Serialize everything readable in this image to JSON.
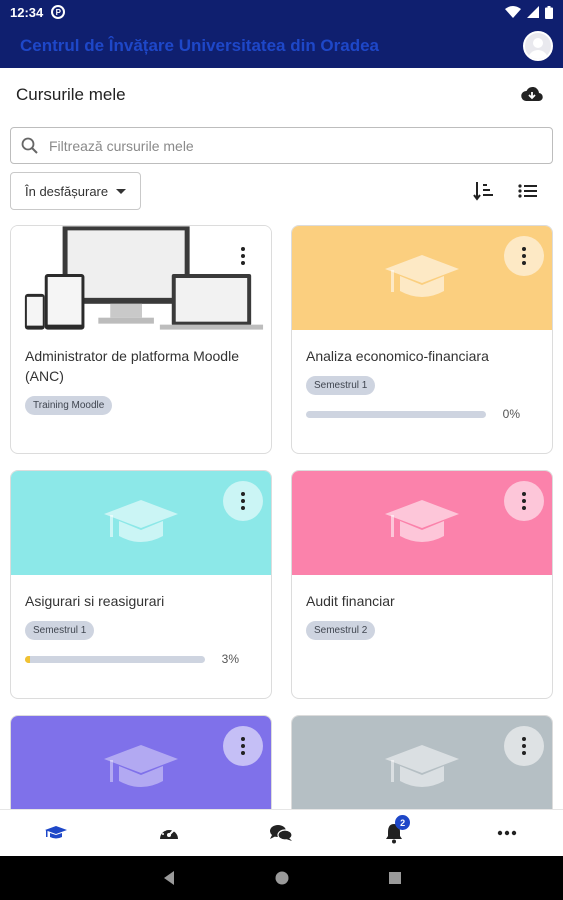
{
  "status_bar": {
    "time": "12:34",
    "notification_icon": "P"
  },
  "app_bar": {
    "title": "Centrul de Învățare Universitatea din Oradea"
  },
  "page": {
    "title": "Cursurile mele"
  },
  "search": {
    "placeholder": "Filtrează cursurile mele"
  },
  "filter": {
    "selected": "În desfășurare"
  },
  "courses": [
    {
      "name": "Administrator de platforma Moodle (ANC)",
      "category": "Training Moodle",
      "image": "devices-illustration",
      "color": "#ffffff",
      "progress": null
    },
    {
      "name": "Analiza economico-financiara",
      "category": "Semestrul 1",
      "image": "graduation-cap",
      "color": "#fbcf7f",
      "progress": 0,
      "progress_label": "0%"
    },
    {
      "name": "Asigurari si reasigurari",
      "category": "Semestrul 1",
      "image": "graduation-cap",
      "color": "#8ce8e8",
      "progress": 3,
      "progress_label": "3%"
    },
    {
      "name": "Audit financiar",
      "category": "Semestrul 2",
      "image": "graduation-cap",
      "color": "#fb82ab",
      "progress": null
    },
    {
      "name": "",
      "category": "",
      "image": "graduation-cap",
      "color": "#7f71ea",
      "progress": null
    },
    {
      "name": "",
      "category": "",
      "image": "graduation-cap",
      "color": "#b5bfc4",
      "progress": null
    }
  ],
  "bottom_nav": [
    {
      "icon": "graduation-cap-icon",
      "active": true
    },
    {
      "icon": "dashboard-icon",
      "active": false
    },
    {
      "icon": "messages-icon",
      "active": false
    },
    {
      "icon": "notifications-icon",
      "active": false,
      "badge": "2"
    },
    {
      "icon": "more-icon",
      "active": false
    }
  ],
  "colors": {
    "primary": "#0f1f6f",
    "accent": "#1e47c8"
  }
}
